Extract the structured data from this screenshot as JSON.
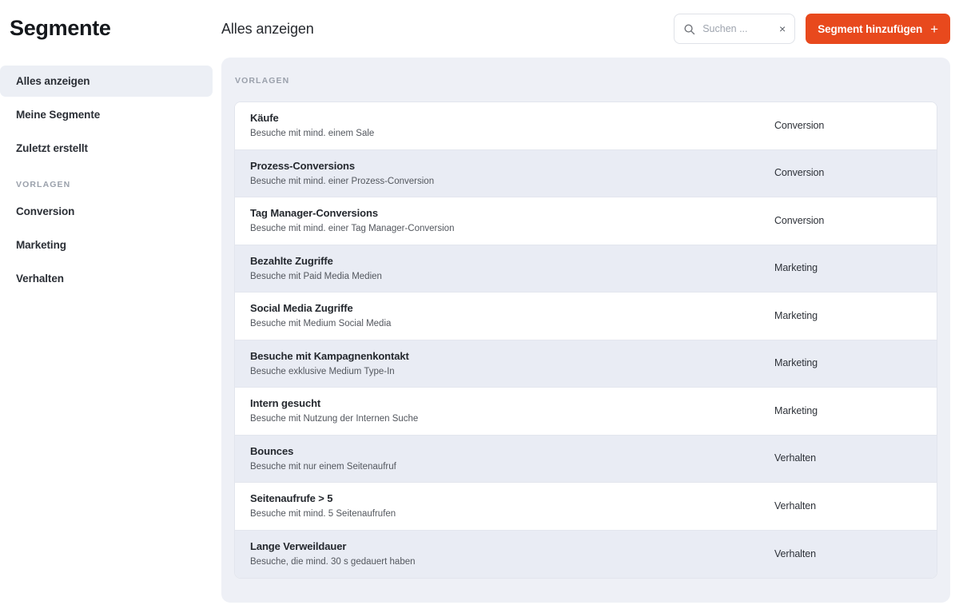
{
  "sidebar": {
    "brand": "Segmente",
    "items": [
      {
        "label": "Alles anzeigen",
        "active": true
      },
      {
        "label": "Meine Segmente",
        "active": false
      },
      {
        "label": "Zuletzt erstellt",
        "active": false
      }
    ],
    "group_label": "VORLAGEN",
    "template_items": [
      {
        "label": "Conversion"
      },
      {
        "label": "Marketing"
      },
      {
        "label": "Verhalten"
      }
    ]
  },
  "header": {
    "title": "Alles anzeigen",
    "search": {
      "placeholder": "Suchen ...",
      "value": "",
      "icon": "search-icon",
      "clear_icon": "×"
    },
    "add_button": {
      "label": "Segment hinzufügen",
      "plus": "+",
      "color": "#e8491d"
    }
  },
  "panel": {
    "group_label": "VORLAGEN",
    "background": "#eef0f6",
    "rows": [
      {
        "title": "Käufe",
        "desc": "Besuche mit mind. einem Sale",
        "category": "Conversion"
      },
      {
        "title": "Prozess-Conversions",
        "desc": "Besuche mit mind. einer Prozess-Conversion",
        "category": "Conversion"
      },
      {
        "title": "Tag Manager-Conversions",
        "desc": "Besuche mit mind. einer Tag Manager-Conversion",
        "category": "Conversion"
      },
      {
        "title": "Bezahlte Zugriffe",
        "desc": "Besuche mit Paid Media Medien",
        "category": "Marketing"
      },
      {
        "title": "Social Media Zugriffe",
        "desc": "Besuche mit Medium Social Media",
        "category": "Marketing"
      },
      {
        "title": "Besuche mit Kampagnenkontakt",
        "desc": "Besuche exklusive Medium Type-In",
        "category": "Marketing"
      },
      {
        "title": "Intern gesucht",
        "desc": "Besuche mit Nutzung der Internen Suche",
        "category": "Marketing"
      },
      {
        "title": "Bounces",
        "desc": "Besuche mit nur einem Seitenaufruf",
        "category": "Verhalten"
      },
      {
        "title": "Seitenaufrufe > 5",
        "desc": "Besuche mit mind. 5 Seitenaufrufen",
        "category": "Verhalten"
      },
      {
        "title": "Lange Verweildauer",
        "desc": "Besuche, die mind. 30 s gedauert haben",
        "category": "Verhalten"
      }
    ]
  }
}
